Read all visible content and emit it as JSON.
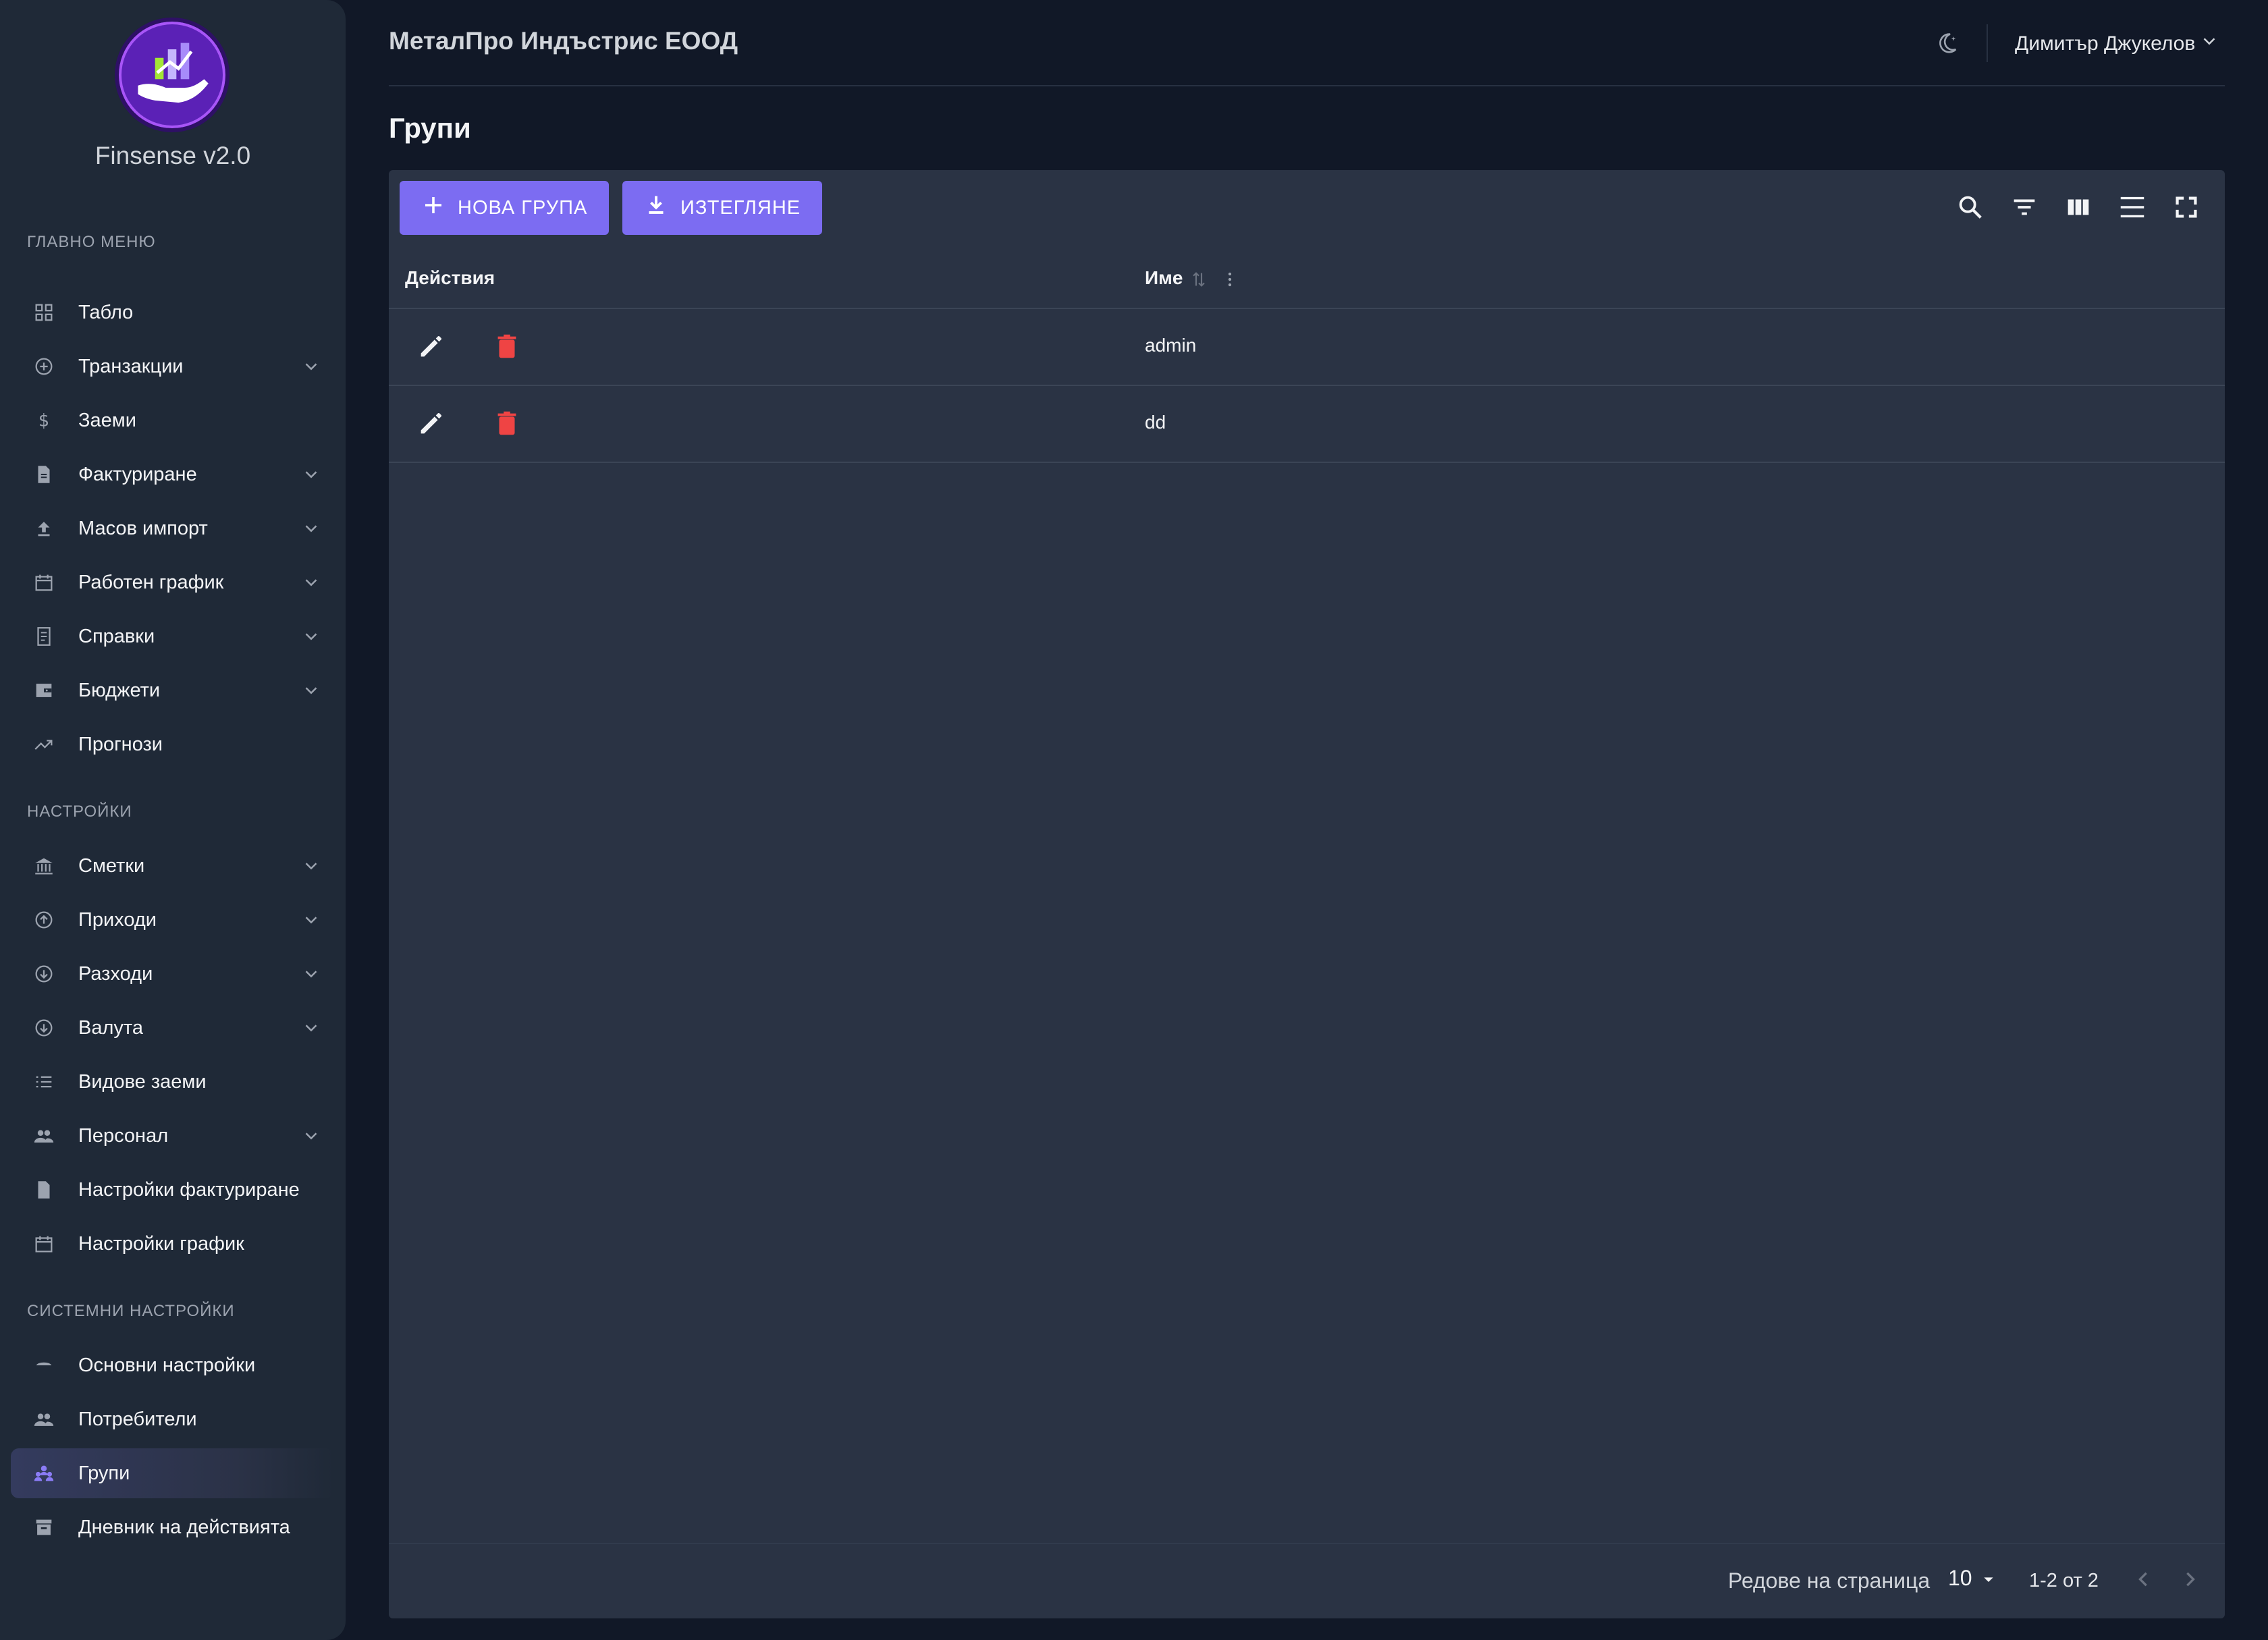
{
  "app": {
    "name": "Finsense v2.0",
    "logo": "finsense-hand-chart-logo"
  },
  "header": {
    "company": "МеталПро Индъстрис ЕООД",
    "user": "Димитър Джукелов",
    "theme_icon": "moon-icon"
  },
  "sidebar": {
    "sections": [
      {
        "title": "ГЛАВНО МЕНЮ"
      },
      {
        "title": "НАСТРОЙКИ"
      },
      {
        "title": "СИСТЕМНИ НАСТРОЙКИ"
      }
    ],
    "items": [
      {
        "label": "Табло",
        "icon": "dashboard-icon",
        "expandable": false
      },
      {
        "label": "Транзакции",
        "icon": "add-circle-icon",
        "expandable": true
      },
      {
        "label": "Заеми",
        "icon": "dollar-icon",
        "expandable": false
      },
      {
        "label": "Фактуриране",
        "icon": "document-icon",
        "expandable": true
      },
      {
        "label": "Масов импорт",
        "icon": "upload-icon",
        "expandable": true
      },
      {
        "label": "Работен график",
        "icon": "calendar-icon",
        "expandable": true
      },
      {
        "label": "Справки",
        "icon": "receipt-icon",
        "expandable": true
      },
      {
        "label": "Бюджети",
        "icon": "wallet-icon",
        "expandable": true
      },
      {
        "label": "Прогнози",
        "icon": "trending-up-icon",
        "expandable": false
      },
      {
        "label": "Сметки",
        "icon": "bank-icon",
        "expandable": true
      },
      {
        "label": "Приходи",
        "icon": "arrow-up-circle-icon",
        "expandable": true
      },
      {
        "label": "Разходи",
        "icon": "arrow-down-circle-icon",
        "expandable": true
      },
      {
        "label": "Валута",
        "icon": "arrow-down-circle-icon",
        "expandable": true
      },
      {
        "label": "Видове заеми",
        "icon": "list-icon",
        "expandable": false
      },
      {
        "label": "Персонал",
        "icon": "people-icon",
        "expandable": true
      },
      {
        "label": "Настройки фактуриране",
        "icon": "document-icon",
        "expandable": false
      },
      {
        "label": "Настройки график",
        "icon": "calendar-icon",
        "expandable": false
      },
      {
        "label": "Основни настройки",
        "icon": "settings-cloud-icon",
        "expandable": false
      },
      {
        "label": "Потребители",
        "icon": "people-icon",
        "expandable": false
      },
      {
        "label": "Групи",
        "icon": "groups-icon",
        "expandable": false,
        "active": true
      },
      {
        "label": "Дневник на действията",
        "icon": "archive-icon",
        "expandable": false
      }
    ]
  },
  "page": {
    "title": "Групи"
  },
  "toolbar": {
    "new_group_label": "НОВА ГРУПА",
    "export_label": "ИЗТЕГЛЯНЕ",
    "icons": [
      "search-icon",
      "filter-icon",
      "columns-icon",
      "density-icon",
      "fullscreen-icon"
    ]
  },
  "table": {
    "columns": [
      "Действия",
      "Име"
    ],
    "rows": [
      {
        "name": "admin"
      },
      {
        "name": "dd"
      }
    ]
  },
  "pagination": {
    "rows_per_page_label": "Редове на страница",
    "rows_per_page": "10",
    "range": "1-2 от 2"
  },
  "colors": {
    "accent": "#7c6cf2",
    "delete": "#ef4444",
    "sidebar_bg": "#1f2937",
    "page_bg": "#111827",
    "card_bg": "#2a3344"
  }
}
